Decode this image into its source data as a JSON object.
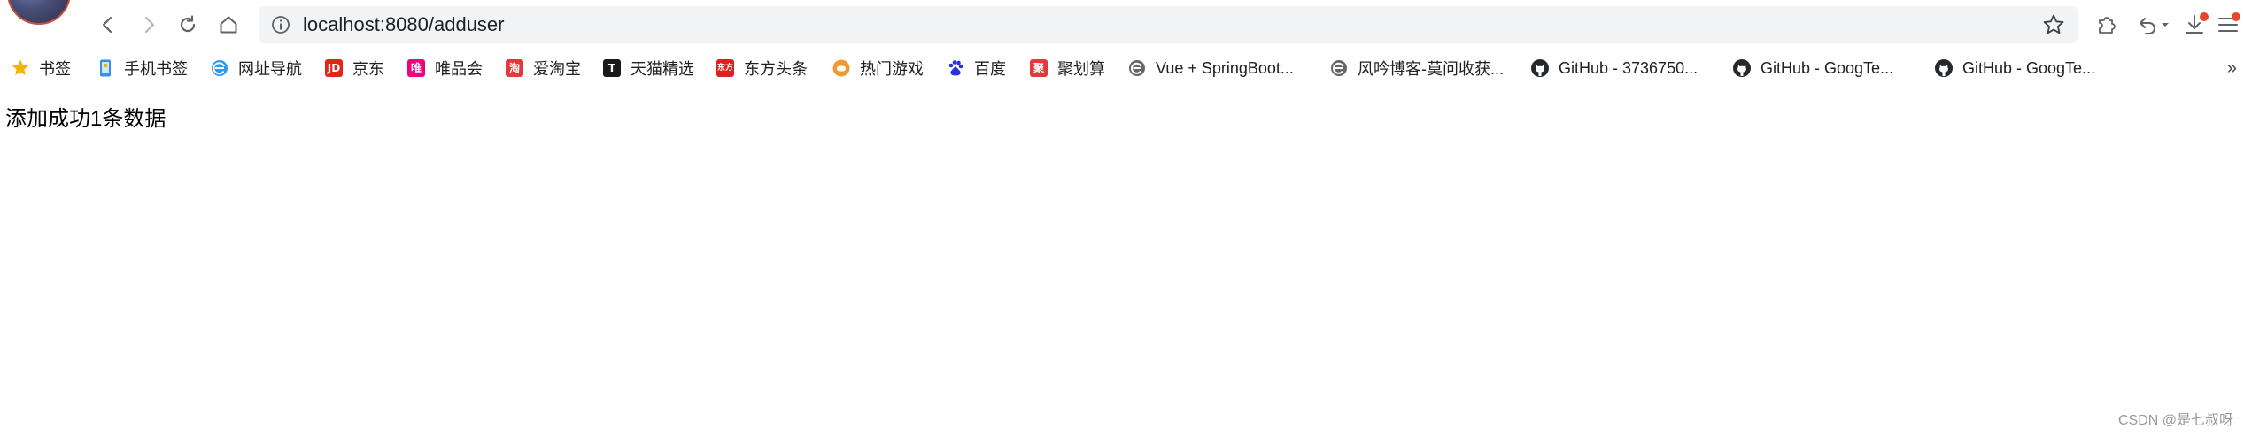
{
  "browser": {
    "url": "localhost:8080/adduser",
    "nav": {
      "back_icon": "chevron-left-icon",
      "forward_icon": "chevron-right-icon",
      "reload_icon": "reload-icon",
      "home_icon": "home-icon"
    },
    "right_icons": [
      "extensions-icon",
      "undo-icon",
      "download-icon",
      "menu-icon"
    ]
  },
  "bookmarks": {
    "items": [
      {
        "label": "书签",
        "icon": "star-icon",
        "color": "#f5b400"
      },
      {
        "label": "手机书签",
        "icon": "phone-icon",
        "color": "#3a8ee6"
      },
      {
        "label": "网址导航",
        "icon": "browser-e-icon",
        "color": "#2b9af3"
      },
      {
        "label": "京东",
        "icon": "jd-icon",
        "icon_text": "JD",
        "color": "#e1251b"
      },
      {
        "label": "唯品会",
        "icon": "vip-icon",
        "icon_text": "唯",
        "color": "#f10180"
      },
      {
        "label": "爱淘宝",
        "icon": "taobao-icon",
        "icon_text": "淘",
        "color": "#e4393c"
      },
      {
        "label": "天猫精选",
        "icon": "tmall-icon",
        "icon_text": "T",
        "color": "#e1251b"
      },
      {
        "label": "东方头条",
        "icon": "dongfang-icon",
        "icon_text": "东方",
        "color": "#e02020"
      },
      {
        "label": "热门游戏",
        "icon": "game-icon",
        "color": "#f29a32"
      },
      {
        "label": "百度",
        "icon": "baidu-icon",
        "color": "#2932e1"
      },
      {
        "label": "聚划算",
        "icon": "juhuasuan-icon",
        "icon_text": "聚",
        "color": "#e4393c"
      },
      {
        "label": "Vue + SpringBoot...",
        "icon": "browser-e-icon",
        "color": "#666666"
      },
      {
        "label": "风吟博客-莫问收获...",
        "icon": "browser-e-icon",
        "color": "#666666"
      },
      {
        "label": "GitHub - 3736750...",
        "icon": "github-icon",
        "color": "#24292e"
      },
      {
        "label": "GitHub - GoogTe...",
        "icon": "github-icon",
        "color": "#24292e"
      },
      {
        "label": "GitHub - GoogTe...",
        "icon": "github-icon",
        "color": "#24292e"
      }
    ],
    "more": "»"
  },
  "page": {
    "message": "添加成功1条数据",
    "watermark": "CSDN @是七叔呀"
  },
  "colors": {
    "omnibox_bg": "#f1f3f4",
    "badge": "#e8462b"
  }
}
